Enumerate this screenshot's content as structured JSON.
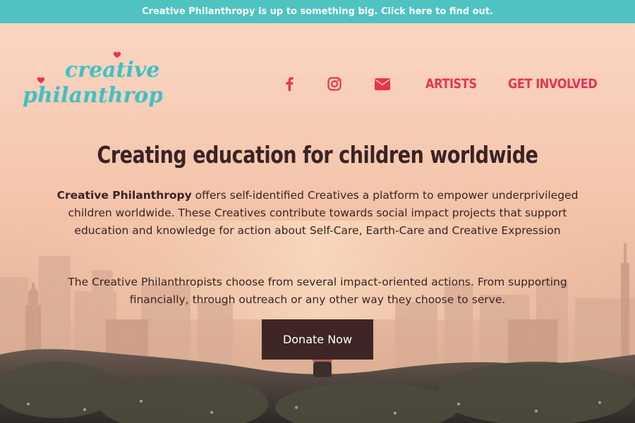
{
  "announcement": {
    "text": "Creative Philanthropy is up to something big. Click here to find out."
  },
  "logo": {
    "line1": "creative",
    "line2": "philanthropy"
  },
  "nav": {
    "icons": [
      "facebook-icon",
      "instagram-icon",
      "envelope-icon"
    ],
    "artists_label": "ARTISTS",
    "get_involved_label": "GET INVOLVED"
  },
  "hero": {
    "headline": "Creating education for children worldwide",
    "para1_brand": "Creative Philanthropy",
    "para1_rest": " offers self-identified Creatives a platform to empower underprivileged children worldwide. These Creatives contribute towards social impact projects that support education and knowledge for action about Self-Care, Earth-Care and Creative Expression",
    "para2": "The Creative Philanthropists choose from several impact-oriented actions. From supporting financially, through outreach or any other way they choose to serve.",
    "donate_label": "Donate Now"
  },
  "colors": {
    "announce_bg": "#4ec3c2",
    "accent": "#e8334f",
    "logo_teal": "#3fc1c4",
    "text_dark": "#3a2323",
    "button_bg": "#3d2623"
  }
}
